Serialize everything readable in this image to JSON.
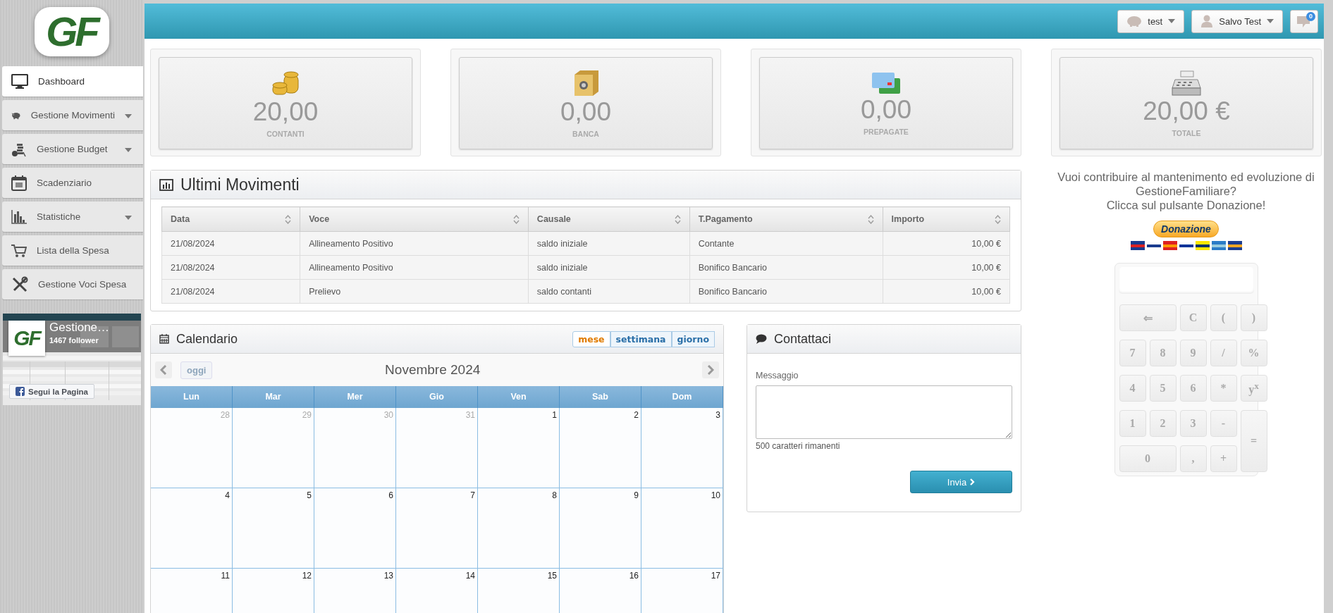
{
  "logo": {
    "text": "GF"
  },
  "sidebar": {
    "items": [
      {
        "label": "Dashboard",
        "selected": true,
        "has_menu": false
      },
      {
        "label": "Gestione Movimenti",
        "selected": false,
        "has_menu": true
      },
      {
        "label": "Gestione Budget",
        "selected": false,
        "has_menu": true
      },
      {
        "label": "Scadenziario",
        "selected": false,
        "has_menu": false
      },
      {
        "label": "Statistiche",
        "selected": false,
        "has_menu": true
      },
      {
        "label": "Lista della Spesa",
        "selected": false,
        "has_menu": false
      },
      {
        "label": "Gestione Voci Spesa",
        "selected": false,
        "has_menu": false
      }
    ]
  },
  "facebook_widget": {
    "logo": "GF",
    "title": "Gestione…",
    "followers": "1467 follower",
    "button": "Segui la Pagina"
  },
  "top_bar": {
    "account": "test",
    "user": "Salvo Test",
    "messages_badge": "0"
  },
  "summary_cards": [
    {
      "value": "20,00",
      "label": "CONTANTI"
    },
    {
      "value": "0,00",
      "label": "BANCA"
    },
    {
      "value": "0,00",
      "label": "PREPAGATE"
    },
    {
      "value": "20,00 €",
      "label": "TOTALE"
    }
  ],
  "movements": {
    "title": "Ultimi Movimenti",
    "columns": [
      "Data",
      "Voce",
      "Causale",
      "T.Pagamento",
      "Importo"
    ],
    "rows": [
      [
        "21/08/2024",
        "Allineamento Positivo",
        "saldo iniziale",
        "Contante",
        "10,00 €"
      ],
      [
        "21/08/2024",
        "Allineamento Positivo",
        "saldo iniziale",
        "Bonifico Bancario",
        "10,00 €"
      ],
      [
        "21/08/2024",
        "Prelievo",
        "saldo contanti",
        "Bonifico Bancario",
        "10,00 €"
      ]
    ]
  },
  "calendar": {
    "title": "Calendario",
    "views": [
      {
        "label": "mese",
        "selected": true
      },
      {
        "label": "settimana",
        "selected": false
      },
      {
        "label": "giorno",
        "selected": false
      }
    ],
    "today_button": {
      "label": "oggi",
      "disabled": true
    },
    "month": "Novembre 2024",
    "weekdays": [
      "Lun",
      "Mar",
      "Mer",
      "Gio",
      "Ven",
      "Sab",
      "Dom"
    ],
    "weeks": [
      [
        {
          "day": "28",
          "other_month": true
        },
        {
          "day": "29",
          "other_month": true
        },
        {
          "day": "30",
          "other_month": true
        },
        {
          "day": "31",
          "other_month": true
        },
        {
          "day": "1",
          "other_month": false
        },
        {
          "day": "2",
          "other_month": false
        },
        {
          "day": "3",
          "other_month": false
        }
      ],
      [
        {
          "day": "4",
          "other_month": false
        },
        {
          "day": "5",
          "other_month": false
        },
        {
          "day": "6",
          "other_month": false
        },
        {
          "day": "7",
          "other_month": false
        },
        {
          "day": "8",
          "other_month": false
        },
        {
          "day": "9",
          "other_month": false
        },
        {
          "day": "10",
          "other_month": false
        }
      ],
      [
        {
          "day": "11",
          "other_month": false
        },
        {
          "day": "12",
          "other_month": false
        },
        {
          "day": "13",
          "other_month": false
        },
        {
          "day": "14",
          "other_month": false
        },
        {
          "day": "15",
          "other_month": false
        },
        {
          "day": "16",
          "other_month": false
        },
        {
          "day": "17",
          "other_month": false
        }
      ]
    ]
  },
  "contact": {
    "title": "Contattaci",
    "field_label": "Messaggio",
    "counter": "500 caratteri rimanenti",
    "submit": "Invia"
  },
  "donation": {
    "text": [
      "Vuoi contribuire al mantenimento ed evoluzione di GestioneFamiliare?",
      "Clicca sul pulsante Donazione!"
    ],
    "button": "Donazione"
  },
  "calculator": {
    "keys": [
      {
        "label": "⇐",
        "kind": "wide"
      },
      {
        "label": "C",
        "kind": "key"
      },
      {
        "label": "(",
        "kind": "key"
      },
      {
        "label": ")",
        "kind": "key"
      },
      {
        "label": "7",
        "kind": "key"
      },
      {
        "label": "8",
        "kind": "key"
      },
      {
        "label": "9",
        "kind": "key"
      },
      {
        "label": "/",
        "kind": "key"
      },
      {
        "label": "%",
        "kind": "key"
      },
      {
        "label": "4",
        "kind": "key"
      },
      {
        "label": "5",
        "kind": "key"
      },
      {
        "label": "6",
        "kind": "key"
      },
      {
        "label": "*",
        "kind": "key"
      },
      {
        "label": "y$^{x}$",
        "kind": "key"
      },
      {
        "label": "1",
        "kind": "key"
      },
      {
        "label": "2",
        "kind": "key"
      },
      {
        "label": "3",
        "kind": "key"
      },
      {
        "label": "-",
        "kind": "key"
      },
      {
        "label": "=",
        "kind": "tall"
      },
      {
        "label": "0",
        "kind": "wide"
      },
      {
        "label": ",",
        "kind": "key"
      },
      {
        "label": "+",
        "kind": "key"
      }
    ]
  }
}
